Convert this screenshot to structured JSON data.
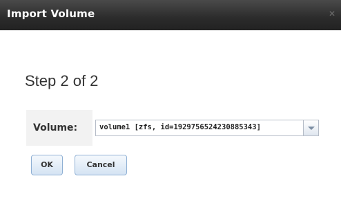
{
  "dialog": {
    "title": "Import Volume",
    "close_glyph": "✕"
  },
  "step": {
    "heading": "Step 2 of 2"
  },
  "form": {
    "volume_label": "Volume:",
    "volume_selected": "volume1 [zfs, id=1929756524230885343]"
  },
  "buttons": {
    "ok": "OK",
    "cancel": "Cancel"
  }
}
